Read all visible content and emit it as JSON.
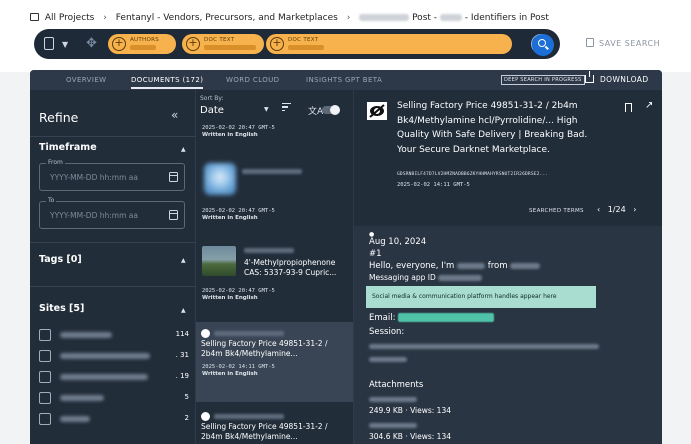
{
  "breadcrumb": {
    "root": "All Projects",
    "project": "Fentanyl - Vendors, Precursors, and Marketplaces",
    "post_suffix": "Post -",
    "section": "- Identifiers in Post"
  },
  "search": {
    "pills": [
      {
        "label": "AUTHORS"
      },
      {
        "label": "DOC TEXT"
      },
      {
        "label": "DOC TEXT"
      }
    ],
    "save_label": "SAVE SEARCH"
  },
  "tabs": [
    {
      "label": "OVERVIEW"
    },
    {
      "label": "DOCUMENTS (172)"
    },
    {
      "label": "WORD CLOUD"
    },
    {
      "label": "INSIGHTS GPT BETA"
    }
  ],
  "deep_search": "DEEP SEARCH IN PROGRESS",
  "download": "DOWNLOAD",
  "refine": {
    "title": "Refine",
    "collapse": "«",
    "timeframe": {
      "title": "Timeframe",
      "from_label": "From",
      "to_label": "To",
      "placeholder": "YYYY-MM-DD hh:mm aa"
    },
    "tags_title": "Tags [0]",
    "sites_title": "Sites [5]",
    "sites": [
      {
        "count": "114"
      },
      {
        "count": ". 31"
      },
      {
        "count": ". 19"
      },
      {
        "count": "5"
      },
      {
        "count": "2"
      }
    ]
  },
  "sort": {
    "label": "Sort By:",
    "value": "Date"
  },
  "documents": [
    {
      "date": "2025-02-02 20:47 GMT-5",
      "lang": "Written in English"
    },
    {
      "date": "2025-02-02 20:47 GMT-5",
      "lang": "Written in English"
    },
    {
      "title": "4'-Methylpropiophenone CAS: 5337-93-9 Cupric...",
      "date": "2025-02-02 20:47 GMT-5",
      "lang": "Written in English"
    },
    {
      "title": "Selling Factory Price 49851-31-2 / 2b4m Bk4/Methylamine...",
      "date": "2025-02-02 14:11 GMT-5",
      "lang": "Written in English"
    },
    {
      "title": "Selling Factory Price 49851-31-2 / 2b4m Bk4/Methylamine..."
    }
  ],
  "detail": {
    "title": "Selling Factory Price 49851-31-2 / 2b4m Bk4/Methylamine hcl/Pyrrolidine/... High Quality With Safe Delivery | Breaking Bad. Your Secure Darknet Marketplace.",
    "hash": "GDSRNBILF47D7LV2HMZNADBB6ZKYHHMAHYRSNUT2IR26DRSE2...",
    "date": "2025-02-02 14:11 GMT-5",
    "searched_terms": "SEARCHED TERMS",
    "pager": "1/24",
    "post_date": "Aug 10, 2024",
    "post_num": "#1",
    "hello": "Hello, everyone, I'm",
    "from": "from",
    "messaging": "Messaging app ID",
    "callout": "Social media & communication platform handles appear here",
    "email_label": "Email:",
    "session_label": "Session:",
    "attachments": "Attachments",
    "att1": "249.9 KB · Views: 134",
    "att2": "304.6 KB · Views: 134"
  }
}
